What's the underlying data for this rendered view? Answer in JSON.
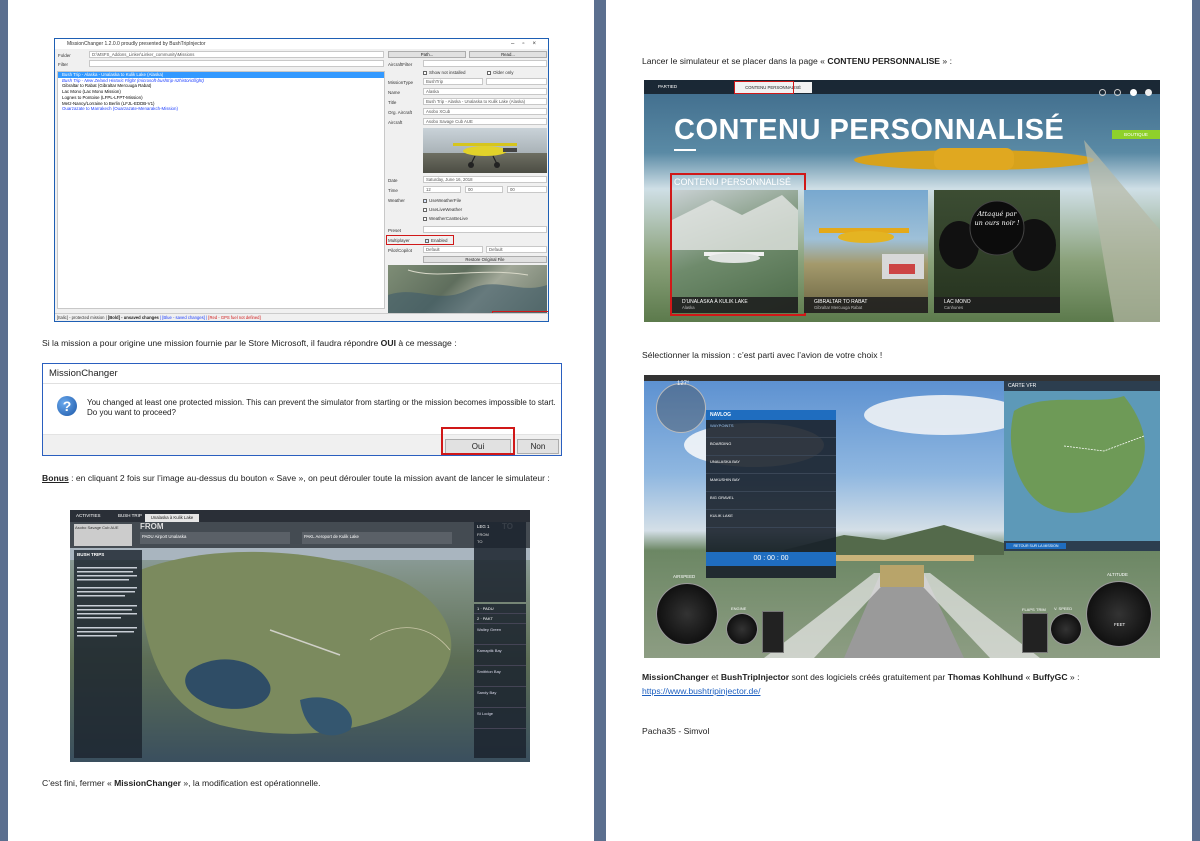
{
  "left_page": {
    "mission_changer": {
      "window_title": "MissionChanger 1.2.0.0 proudly presented by BushTripInjector",
      "folder_label": "Folder",
      "folder_value": "D:\\MSFS_Addons_Linker\\Linker_community\\Missions",
      "filter_label": "Filter",
      "path_button": "Path...",
      "read_button": "Read...",
      "missions": [
        {
          "name": "Bush Trip - Alaska - Unalaska to Kulik Lake (Alaska)",
          "style": "sel"
        },
        {
          "name": "Bush Trip - New Zeland Historic Flight (microsoft-bushtrip-nzhistoricflight)",
          "style": "blue"
        },
        {
          "name": "Gibraltar to Rabat (Gibraltar Mercuuga Rabat)",
          "style": "normal"
        },
        {
          "name": "Lac Mono (Lac Mono Mission)",
          "style": "normal"
        },
        {
          "name": "Lognes to Pontoise (LFPL-LFPT-Mission)",
          "style": "normal"
        },
        {
          "name": "Metz-Nancy/Lorraine to Berlin (LFJL-EDDB-V1)",
          "style": "normal"
        },
        {
          "name": "Ouarzazate to Marrakech (Ouarzazate-Menarakch-Mission)",
          "style": "dblue"
        }
      ],
      "fields": [
        {
          "label": "AircraftFilter",
          "value": ""
        },
        {
          "label": "MissionType",
          "value": "BushTrip"
        },
        {
          "label": "Name",
          "value": "Alaska"
        },
        {
          "label": "Title",
          "value": "Bush Trip - Alaska - Unalaska to Kulik Lake (Alaska)"
        },
        {
          "label": "Org. Aircraft",
          "value": "Asobo XCub"
        },
        {
          "label": "Aircraft",
          "value": "Asobo Savage Cub AUE"
        }
      ],
      "show_not_installed": "Show not installed",
      "older_only": "Older only",
      "date_label": "Date",
      "date_value": "Saturday, June 16, 2018",
      "time_label": "Time",
      "time_h": "12",
      "time_m": "00",
      "time_s": "00",
      "weather_label": "Weather",
      "weather_opts": [
        "UseWeatherFile",
        "UseLiveWeather",
        "WeatherCanBeLive"
      ],
      "preset_label": "Preset",
      "multiplayer_label": "Multiplayer",
      "multiplayer_value": "Enabled",
      "pilot_label": "Pilot/Copilot",
      "pilot_value": "Default",
      "copilot_value": "Default",
      "restore_button": "Restore Original File",
      "save_button": "Save",
      "status_parts": [
        {
          "text": "[Italic] - protected mission | ",
          "color": "#333",
          "bold": false
        },
        {
          "text": "[Bold] - unsaved changes",
          "color": "#222",
          "bold": true
        },
        {
          "text": " | [Blue - saved changes] | ",
          "color": "#1a3cff",
          "bold": false
        },
        {
          "text": "[Red - GPS fuel not defined]",
          "color": "#d01818",
          "bold": false
        }
      ]
    },
    "para1_parts": [
      "Si la mission a pour origine une mission fournie par le Store Microsoft, il faudra répondre ",
      "OUI",
      " à ce message :"
    ],
    "dialog": {
      "title": "MissionChanger",
      "message": "You changed at least one protected mission. This can prevent the simulator from starting or the mission becomes impossible to start. Do you want to proceed?",
      "yes": "Oui",
      "no": "Non"
    },
    "para2_parts": [
      "Bonus",
      " : en cliquant  2 fois sur l’image au-dessus du bouton « Save », on peut dérouler toute la mission avant de lancer le simulateur :"
    ],
    "bushtrip": {
      "tabs": [
        "ACTIVITIES",
        "BUSH TRIP"
      ],
      "dest_tab": "Unalaska à Kulik Lake",
      "from_label": "FROM",
      "to_label": "TO",
      "from_airport": "PADU Airport Unalaska",
      "to_airport": "PAKL Aeroport de Kulik Lake",
      "aircraft": "Asobo Savage Cub AUE",
      "brief_title": "BUSH TRIPS",
      "leg_title": "LEG 1",
      "right_rows": [
        "FROM",
        "TO"
      ],
      "side_headers": [
        "1 · PADU",
        "2 · PAKT"
      ],
      "leg_captions": [
        "Walley Green",
        "Kamaptik Bay",
        "Smithton Bay",
        "Sandy Bay",
        "St Lodge"
      ]
    },
    "para3_parts": [
      "C’est fini, fermer « ",
      "MissionChanger",
      " », la modification  est opérationnelle."
    ]
  },
  "right_page": {
    "para1_parts": [
      "Lancer le simulateur et se placer dans la page « ",
      "CONTENU PERSONNALISE",
      "  » :"
    ],
    "msfs_menu": {
      "top_tab": "PARTIED",
      "active_tab": "CONTENU PERSONNALISÉ",
      "big_title": "CONTENU PERSONNALISÉ",
      "boutique": "BOUTIQUE",
      "section_title": "CONTENU PERSONNALISÉ",
      "tiles": [
        {
          "title": "D'UNALASKA À KULIK LAKE",
          "sub": "Alaska"
        },
        {
          "title": "GIBRALTAR TO RABAT",
          "sub": "Gibraltar Mercuuga Rabat"
        },
        {
          "title": "LAC MONO",
          "sub": "Canhunes"
        }
      ],
      "bear_caption": "Attaqué par un ours noir !"
    },
    "para2": "Sélectionner la mission : c’est parti avec l’avion de votre choix !",
    "cockpit": {
      "navlog_title": "NAVLOG",
      "map_title": "CARTE VFR",
      "heading_val": "127°",
      "altitude_label": "ALTITUDE",
      "airspeed_label": "AIRSPEED",
      "feet_label": "FEET",
      "rpm_label": "ENGINE",
      "timer": "00 : 00 : 00",
      "map_button": "RETOUR SUR LA MISSION",
      "waypoints": [
        "WAYPOINTS",
        "BOARDING",
        "UNALASKA BAY",
        "MAKUSHIN BAY",
        "BIG GRAVEL",
        "KULIK LAKE"
      ],
      "flaps_label": "FLAPS",
      "trim_label": "TRIM",
      "vspeed_label": "V. SPEED"
    },
    "para3_parts": [
      "MissionChanger",
      " et ",
      "BushTripInjector",
      "  sont des logiciels  créés gratuitement  par  ",
      "Thomas Kohlhund",
      "  « ",
      "BuffyGC",
      " » :"
    ],
    "link": "https://www.bushtripinjector.de/",
    "signature": "Pacha35  - Simvol"
  },
  "colors": {
    "desktop": "#5b6f8f",
    "accent_red": "#d01818",
    "selection_blue": "#3399ff",
    "link_blue": "#1a5dbf"
  }
}
